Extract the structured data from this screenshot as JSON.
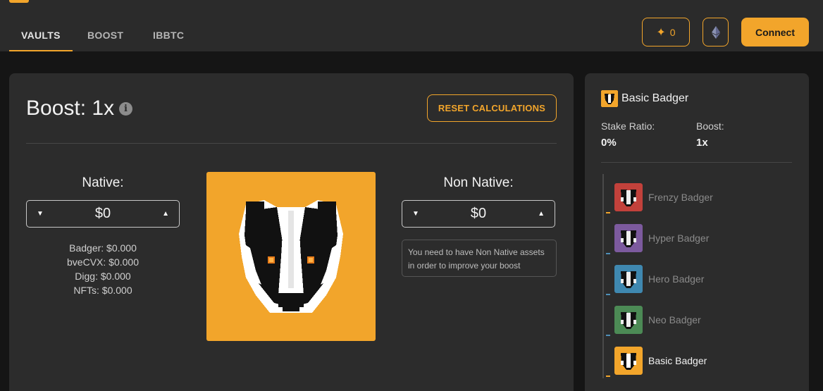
{
  "nav": {
    "tabs": [
      {
        "label": "VAULTS",
        "active": true
      },
      {
        "label": "BOOST",
        "active": false
      },
      {
        "label": "IBBTC",
        "active": false
      }
    ],
    "points_count": "0",
    "network_icon": "ethereum-icon",
    "connect_label": "Connect"
  },
  "calculator": {
    "title": "Boost: 1x",
    "reset_label": "RESET CALCULATIONS",
    "native": {
      "label": "Native:",
      "value": "$0",
      "breakdown": [
        "Badger: $0.000",
        "bveCVX: $0.000",
        "Digg: $0.000",
        "NFTs: $0.000"
      ]
    },
    "non_native": {
      "label": "Non Native:",
      "value": "$0",
      "hint": "You need to have Non Native assets in order to improve your boost"
    }
  },
  "rank": {
    "current_name": "Basic Badger",
    "stake_ratio_label": "Stake Ratio:",
    "stake_ratio_value": "0%",
    "boost_label": "Boost:",
    "boost_value": "1x",
    "tiers": [
      {
        "name": "Frenzy Badger",
        "color": "#c2413b",
        "tick": "#f2a52b",
        "current": false
      },
      {
        "name": "Hyper Badger",
        "color": "#7c5a9e",
        "tick": "#4f8fb8",
        "current": false
      },
      {
        "name": "Hero Badger",
        "color": "#3f88b0",
        "tick": "#4f8fb8",
        "current": false
      },
      {
        "name": "Neo Badger",
        "color": "#4c8a55",
        "tick": "#4f8fb8",
        "current": false
      },
      {
        "name": "Basic Badger",
        "color": "#f2a52b",
        "tick": "#f2a52b",
        "current": true
      }
    ]
  },
  "colors": {
    "accent": "#f2a52b",
    "panel": "#2c2c2c",
    "background": "#151515"
  }
}
